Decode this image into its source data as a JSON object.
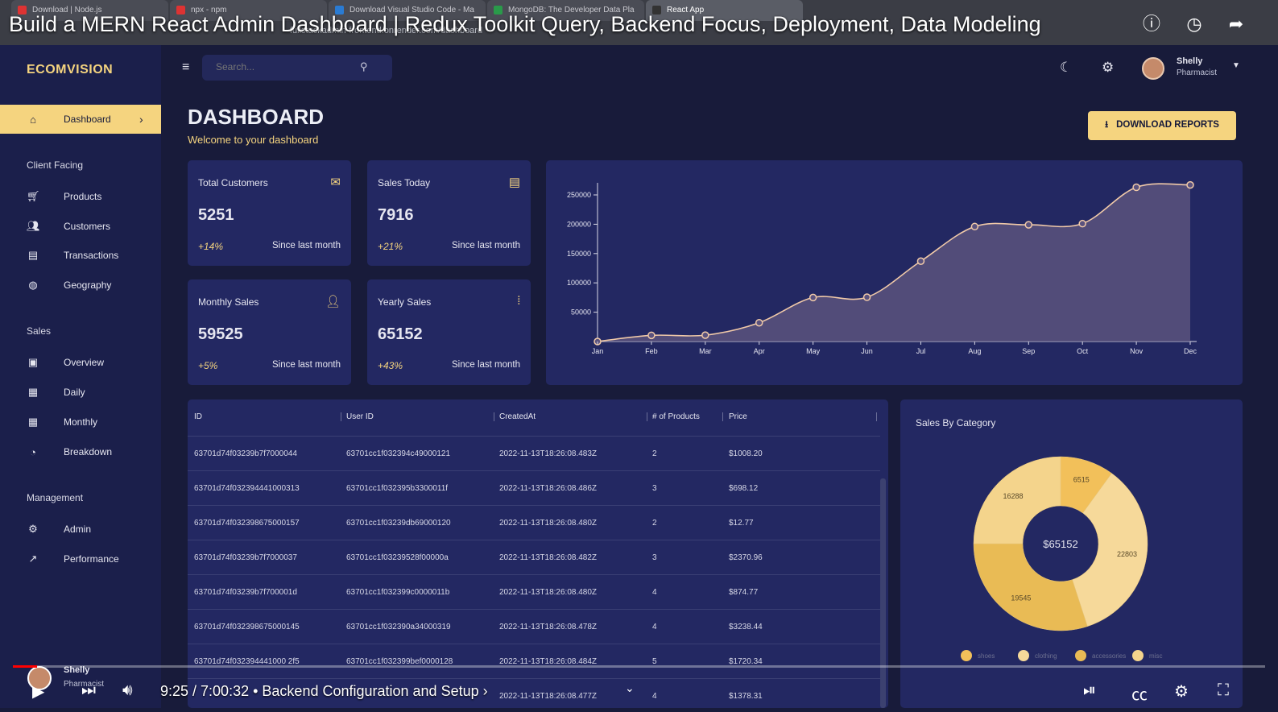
{
  "video": {
    "title": "Build a MERN React Admin Dashboard | Redux Toolkit Query, Backend Focus, Deployment, Data Modeling",
    "time": "9:25 / 7:00:32",
    "chapter": "• Backend Configuration and Setup ›"
  },
  "browser": {
    "tabs": [
      "Download | Node.js",
      "npx - npm",
      "Download Visual Studio Code - Ma",
      "MongoDB: The Developer Data Pla",
      "React App"
    ],
    "url": "fullstackadmin-frontend.onrender.com/dashboard"
  },
  "sidebar": {
    "brand": "ECOMVISION",
    "active": {
      "label": "Dashboard",
      "icon": "home-icon"
    },
    "sections": [
      {
        "title": "Client Facing",
        "items": [
          {
            "label": "Products",
            "icon": "cart-icon"
          },
          {
            "label": "Customers",
            "icon": "groups-icon"
          },
          {
            "label": "Transactions",
            "icon": "receipt-icon"
          },
          {
            "label": "Geography",
            "icon": "globe-icon"
          }
        ]
      },
      {
        "title": "Sales",
        "items": [
          {
            "label": "Overview",
            "icon": "point-of-sale-icon"
          },
          {
            "label": "Daily",
            "icon": "calendar-today-icon"
          },
          {
            "label": "Monthly",
            "icon": "calendar-month-icon"
          },
          {
            "label": "Breakdown",
            "icon": "pie-icon"
          }
        ]
      },
      {
        "title": "Management",
        "items": [
          {
            "label": "Admin",
            "icon": "admin-icon"
          },
          {
            "label": "Performance",
            "icon": "trending-up-icon"
          }
        ]
      }
    ],
    "user": {
      "name": "Shelly",
      "role": "Pharmacist"
    }
  },
  "topbar": {
    "search_placeholder": "Search...",
    "user": {
      "name": "Shelly",
      "role": "Pharmacist"
    }
  },
  "header": {
    "title": "DASHBOARD",
    "subtitle": "Welcome to your dashboard",
    "download_label": "DOWNLOAD REPORTS"
  },
  "stats": [
    {
      "title": "Total Customers",
      "value": "5251",
      "increase": "+14%",
      "desc": "Since last month",
      "icon": "email-icon"
    },
    {
      "title": "Sales Today",
      "value": "7916",
      "increase": "+21%",
      "desc": "Since last month",
      "icon": "point-of-sale-icon"
    },
    {
      "title": "Monthly Sales",
      "value": "59525",
      "increase": "+5%",
      "desc": "Since last month",
      "icon": "person-add-icon"
    },
    {
      "title": "Yearly Sales",
      "value": "65152",
      "increase": "+43%",
      "desc": "Since last month",
      "icon": "traffic-icon"
    }
  ],
  "table": {
    "columns": [
      "ID",
      "User ID",
      "CreatedAt",
      "# of Products",
      "Price"
    ],
    "rows": [
      [
        "63701d74f03239b7f7000044",
        "63701cc1f032394c49000121",
        "2022-11-13T18:26:08.483Z",
        "2",
        "$1008.20"
      ],
      [
        "63701d74f032394441000313",
        "63701cc1f032395b3300011f",
        "2022-11-13T18:26:08.486Z",
        "3",
        "$698.12"
      ],
      [
        "63701d74f032398675000157",
        "63701cc1f03239db69000120",
        "2022-11-13T18:26:08.480Z",
        "2",
        "$12.77"
      ],
      [
        "63701d74f03239b7f7000037",
        "63701cc1f03239528f00000a",
        "2022-11-13T18:26:08.482Z",
        "3",
        "$2370.96"
      ],
      [
        "63701d74f03239b7f700001d",
        "63701cc1f032399c0000011b",
        "2022-11-13T18:26:08.480Z",
        "4",
        "$874.77"
      ],
      [
        "63701d74f032398675000145",
        "63701cc1f032390a34000319",
        "2022-11-13T18:26:08.478Z",
        "4",
        "$3238.44"
      ],
      [
        "63701d74f032394441000 2f5",
        "63701cc1f032399bef0000128",
        "2022-11-13T18:26:08.484Z",
        "5",
        "$1720.34"
      ],
      [
        "",
        "",
        "2022-11-13T18:26:08.477Z",
        "4",
        "$1378.31"
      ]
    ]
  },
  "colors": {
    "accent": "#f5d47f",
    "background": "#181b3a",
    "panel": "#232862",
    "sidebar": "#1b1f4b"
  },
  "chart_data": [
    {
      "type": "area",
      "x": [
        "Jan",
        "Feb",
        "Mar",
        "Apr",
        "May",
        "Jun",
        "Jul",
        "Aug",
        "Sep",
        "Oct",
        "Nov",
        "Dec"
      ],
      "series": [
        {
          "values": [
            0,
            10500,
            10800,
            32000,
            75000,
            75500,
            137000,
            196000,
            199000,
            201000,
            263000,
            267000
          ]
        }
      ],
      "yticks": [
        "250000",
        "200000",
        "150000",
        "100000",
        "50000"
      ],
      "ylim": [
        0,
        280000
      ],
      "grid": false
    },
    {
      "type": "pie",
      "title": "Sales By Category",
      "center_label": "$65152",
      "slices": [
        {
          "label": "shoes",
          "value": 6515,
          "color": "#f2c05a"
        },
        {
          "label": "clothing",
          "value": 22803,
          "color": "#f6d99a"
        },
        {
          "label": "accessories",
          "value": 19545,
          "color": "#e9bb55"
        },
        {
          "label": "misc",
          "value": 16288,
          "color": "#f4d48c"
        }
      ],
      "legend_position": "bottom"
    }
  ]
}
